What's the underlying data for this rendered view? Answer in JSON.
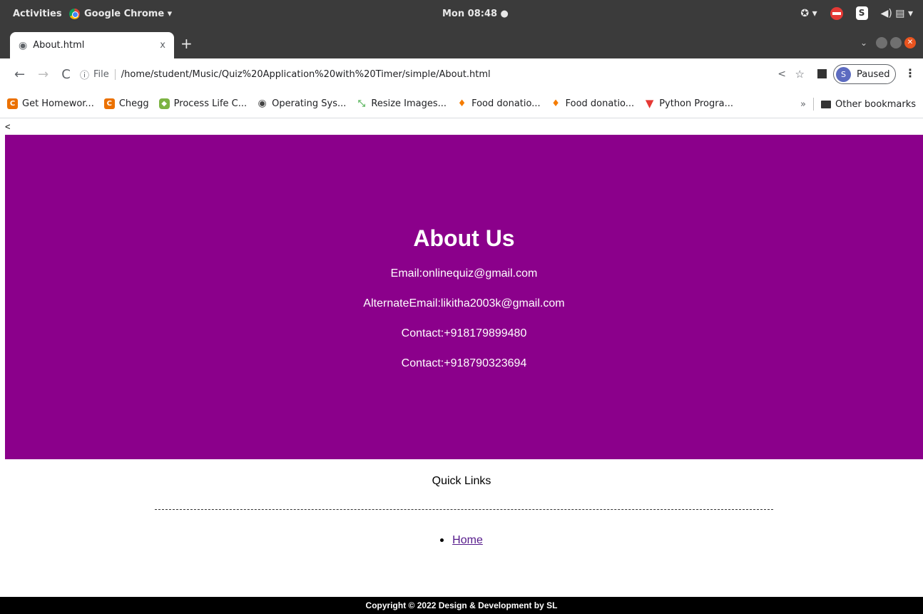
{
  "os_bar": {
    "activities": "Activities",
    "app_name": "Google Chrome ▾",
    "clock": "Mon 08:48 ●",
    "tray_user": "S"
  },
  "browser": {
    "tab_title": "About.html",
    "tab_close": "x",
    "new_tab": "+",
    "url_scheme": "File",
    "url": "/home/student/Music/Quiz%20Application%20with%20Timer/simple/About.html",
    "profile_initial": "S",
    "profile_status": "Paused",
    "bookmarks": [
      {
        "icon": "chegg-icon",
        "glyph": "C",
        "label": "Get Homewor..."
      },
      {
        "icon": "chegg-icon",
        "glyph": "C",
        "label": "Chegg"
      },
      {
        "icon": "hexagon-icon",
        "glyph": "◆",
        "label": "Process Life C..."
      },
      {
        "icon": "globe-icon",
        "glyph": "◉",
        "label": "Operating Sys..."
      },
      {
        "icon": "resize-icon",
        "glyph": "⤡",
        "label": "Resize Images..."
      },
      {
        "icon": "food-icon",
        "glyph": "♦",
        "label": "Food donatio..."
      },
      {
        "icon": "food-icon",
        "glyph": "♦",
        "label": "Food donatio..."
      },
      {
        "icon": "v-icon",
        "glyph": "▼",
        "label": "Python Progra..."
      }
    ],
    "bookmarks_more": "»",
    "other_bookmarks": "Other bookmarks"
  },
  "page": {
    "stray_text": "<",
    "about": {
      "title": "About Us",
      "lines": [
        "Email:onlinequiz@gmail.com",
        "AlternateEmail:likitha2003k@gmail.com",
        "Contact:+918179899480",
        "Contact:+918790323694"
      ],
      "bg_color": "#8b008b"
    },
    "quick_links_title": "Quick Links",
    "links": [
      "Home"
    ],
    "footer": "Copyright © 2022 Design & Development by SL"
  }
}
